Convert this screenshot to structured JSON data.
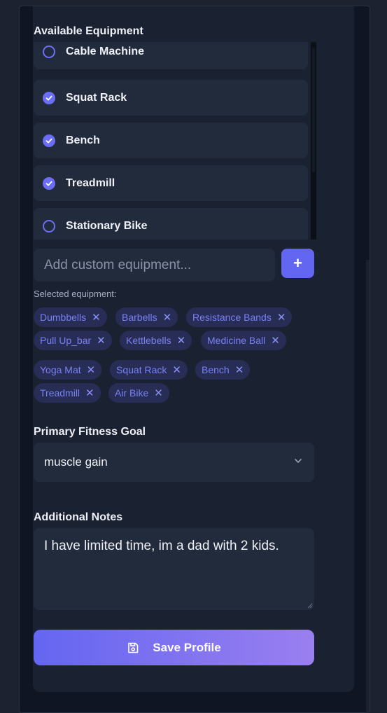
{
  "equipment": {
    "label": "Available Equipment",
    "items": [
      {
        "label": "Cable Machine",
        "checked": false
      },
      {
        "label": "Squat Rack",
        "checked": true
      },
      {
        "label": "Bench",
        "checked": true
      },
      {
        "label": "Treadmill",
        "checked": true
      },
      {
        "label": "Stationary Bike",
        "checked": false
      }
    ],
    "custom_placeholder": "Add custom equipment...",
    "add_label": "+",
    "selected_label": "Selected equipment:",
    "selected": [
      "Dumbbells",
      "Barbells",
      "Resistance Bands",
      "Pull Up_bar",
      "Kettlebells",
      "Medicine Ball",
      "Yoga Mat",
      "Squat Rack",
      "Bench",
      "Treadmill",
      "Air Bike"
    ],
    "remove_glyph": "✕"
  },
  "goal": {
    "label": "Primary Fitness Goal",
    "value": "muscle gain"
  },
  "notes": {
    "label": "Additional Notes",
    "value": "I have limited time, im a dad with 2 kids."
  },
  "save_label": "Save Profile",
  "colors": {
    "accent": "#6366f1",
    "gradient_end": "#9a7ff0",
    "card": "#1a2232",
    "field": "#222b3c",
    "chip_bg": "#272d54",
    "chip_text": "#7b80f5"
  }
}
